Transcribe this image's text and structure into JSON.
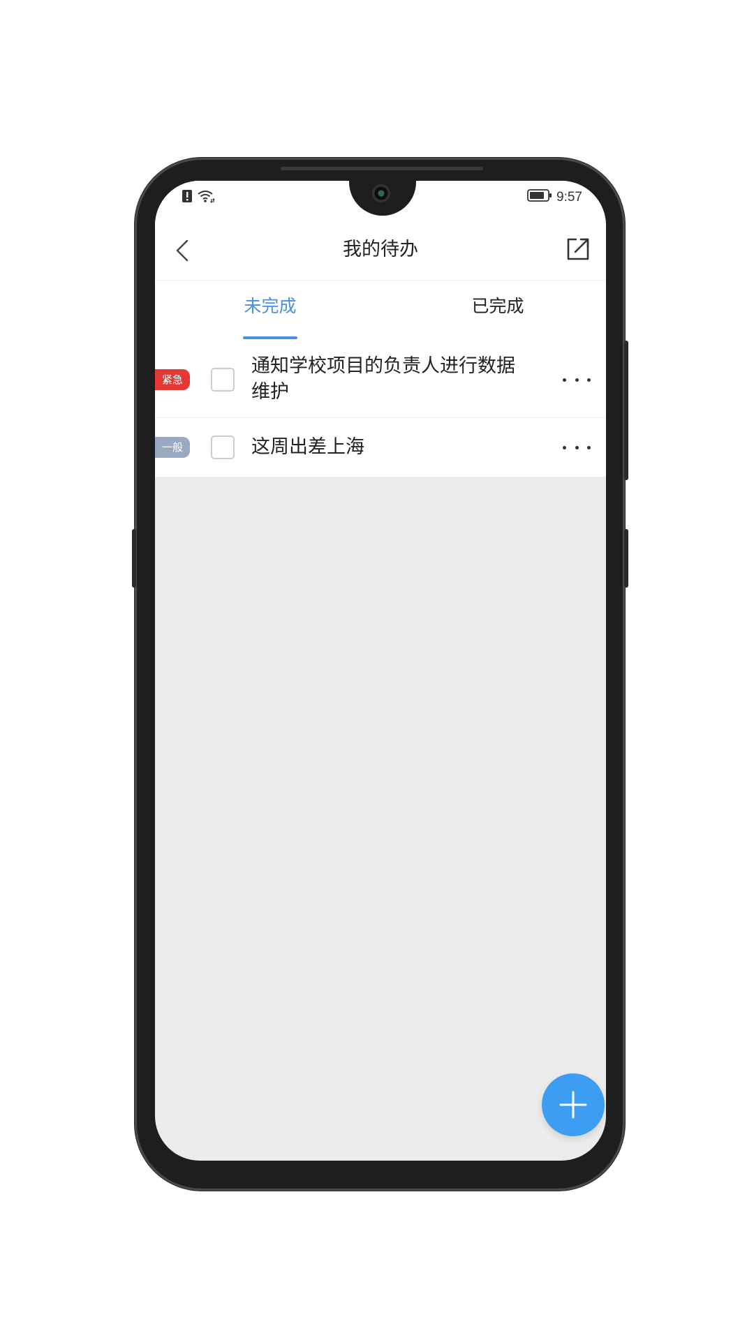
{
  "status_bar": {
    "time": "9:57",
    "icons": [
      "alert-icon",
      "wifi-icon",
      "battery-icon"
    ]
  },
  "nav": {
    "title": "我的待办",
    "back_icon": "chevron-left-icon",
    "share_icon": "external-link-icon"
  },
  "tabs": [
    {
      "label": "未完成",
      "active": true
    },
    {
      "label": "已完成",
      "active": false
    }
  ],
  "tasks": [
    {
      "priority": "紧急",
      "priority_color": "#e53935",
      "text": "通知学校项目的负责人进行数据维护",
      "done": false
    },
    {
      "priority": "一般",
      "priority_color": "#9aa9c2",
      "text": "这周出差上海",
      "done": false
    }
  ],
  "fab": {
    "icon": "plus-icon"
  },
  "colors": {
    "accent": "#4a90e2",
    "fab": "#3d9df2",
    "background": "#ececec"
  }
}
